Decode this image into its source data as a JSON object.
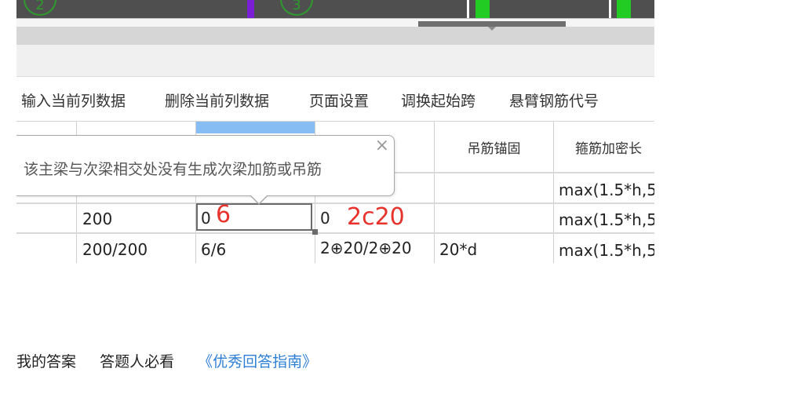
{
  "drawing": {
    "axis_labels": [
      "2",
      "3"
    ],
    "colors": {
      "canvas": "#4f4f4f",
      "axis_bubble": "#2e9a2e",
      "mark_purple": "#7b1fd6",
      "mark_green": "#22cc22",
      "mark_white": "#ffffff"
    }
  },
  "menu": {
    "items": [
      "输入当前列数据",
      "删除当前列数据",
      "页面设置",
      "调换起始跨",
      "悬臂钢筋代号"
    ]
  },
  "table": {
    "headers": [
      "吊筋锚固",
      "箍筋加密长"
    ],
    "rows": [
      {
        "c1": "",
        "c2": "",
        "c3": "",
        "c4": "",
        "c5": "max(1.5*h,5"
      },
      {
        "c1": "200",
        "c2": "0",
        "c3": "0",
        "c4": "",
        "c5": "max(1.5*h,5"
      },
      {
        "c1": "200/200",
        "c2": "6/6",
        "c3": "2⊕20/2⊕20",
        "c4": "20*d",
        "c5": "max(1.5*h,5"
      }
    ],
    "annotations": {
      "after_c2": "6",
      "after_c3": "2c20",
      "color": "#e8322c"
    }
  },
  "tooltip": {
    "text": "该主梁与次梁相交处没有生成次梁加筋或吊筋",
    "close": "×"
  },
  "footer": {
    "my_answer": "我的答案",
    "must_read": "答题人必看",
    "guide_link": "《优秀回答指南》"
  }
}
